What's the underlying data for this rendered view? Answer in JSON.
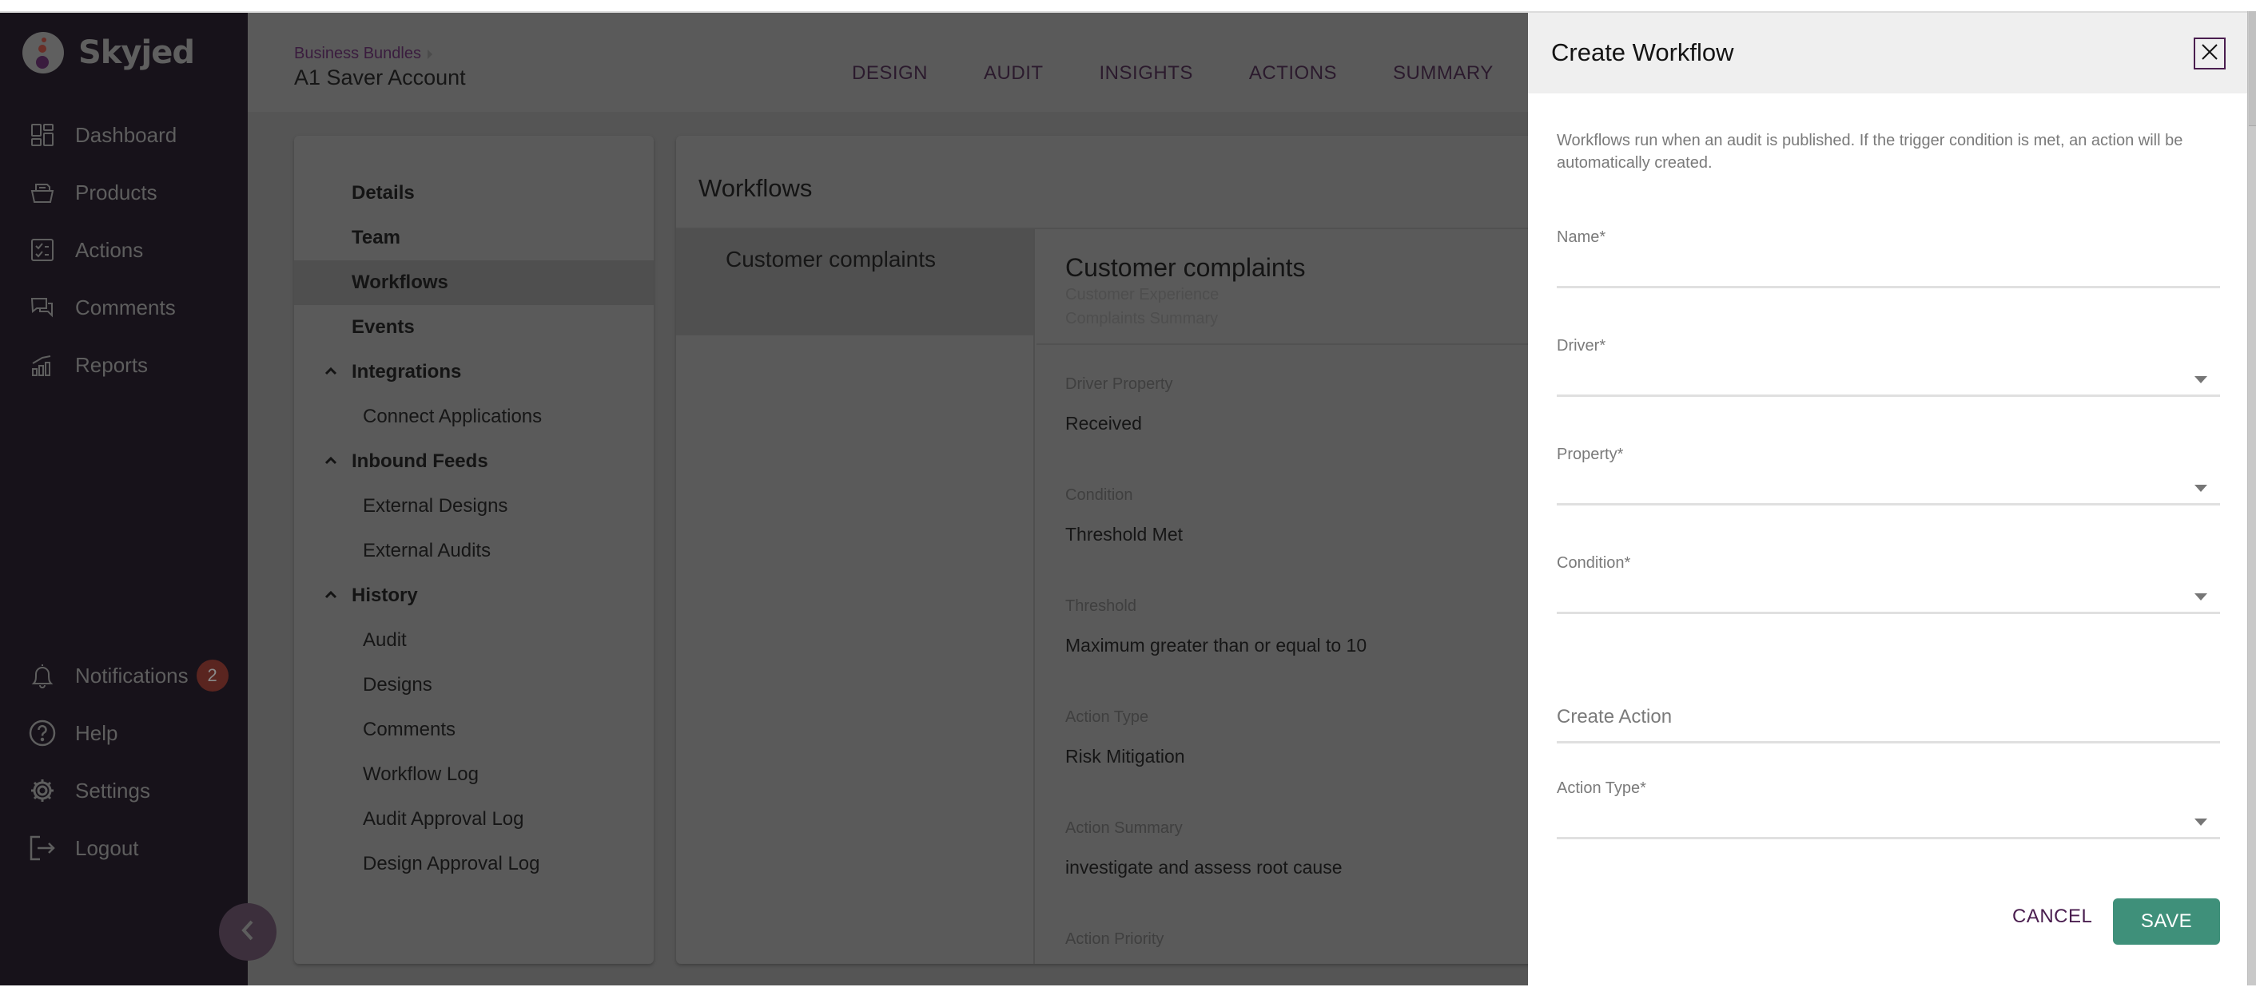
{
  "app": {
    "brand": "Skyjed"
  },
  "sidebar": {
    "items": [
      {
        "label": "Dashboard",
        "icon": "dashboard-icon"
      },
      {
        "label": "Products",
        "icon": "products-icon"
      },
      {
        "label": "Actions",
        "icon": "actions-icon"
      },
      {
        "label": "Comments",
        "icon": "comments-icon"
      },
      {
        "label": "Reports",
        "icon": "reports-icon"
      }
    ],
    "bottom_items": [
      {
        "label": "Notifications",
        "icon": "bell-icon",
        "badge": "2"
      },
      {
        "label": "Help",
        "icon": "help-icon"
      },
      {
        "label": "Settings",
        "icon": "gear-icon"
      },
      {
        "label": "Logout",
        "icon": "logout-icon"
      }
    ],
    "collapse_icon": "chevron-left-icon"
  },
  "header": {
    "breadcrumb": "Business Bundles",
    "title": "A1 Saver Account",
    "tabs": [
      "DESIGN",
      "AUDIT",
      "INSIGHTS",
      "ACTIONS",
      "SUMMARY"
    ]
  },
  "nav_panel": {
    "items": [
      {
        "label": "Details",
        "type": "top"
      },
      {
        "label": "Team",
        "type": "top"
      },
      {
        "label": "Workflows",
        "type": "top",
        "selected": true
      },
      {
        "label": "Events",
        "type": "top"
      },
      {
        "label": "Integrations",
        "type": "group",
        "expanded": true
      },
      {
        "label": "Connect Applications",
        "type": "sub"
      },
      {
        "label": "Inbound Feeds",
        "type": "group",
        "expanded": true
      },
      {
        "label": "External Designs",
        "type": "sub"
      },
      {
        "label": "External Audits",
        "type": "sub"
      },
      {
        "label": "History",
        "type": "group",
        "expanded": true
      },
      {
        "label": "Audit",
        "type": "sub"
      },
      {
        "label": "Designs",
        "type": "sub"
      },
      {
        "label": "Comments",
        "type": "sub"
      },
      {
        "label": "Workflow Log",
        "type": "sub"
      },
      {
        "label": "Audit Approval Log",
        "type": "sub"
      },
      {
        "label": "Design Approval Log",
        "type": "sub"
      }
    ]
  },
  "workflows": {
    "title": "Workflows",
    "list": [
      "Customer complaints"
    ],
    "detail": {
      "name": "Customer complaints",
      "driver": "Customer Experience",
      "summary": "Complaints Summary",
      "fields": [
        {
          "label": "Driver Property",
          "value": "Received"
        },
        {
          "label": "Condition",
          "value": "Threshold Met"
        },
        {
          "label": "Threshold",
          "value": "Maximum greater than or equal to 10"
        },
        {
          "label": "Action Type",
          "value": "Risk Mitigation"
        },
        {
          "label": "Action Summary",
          "value": "investigate and assess root cause"
        },
        {
          "label": "Action Priority",
          "value": ""
        }
      ]
    }
  },
  "dialog": {
    "title": "Create Workflow",
    "description": "Workflows run when an audit is published. If the trigger condition is met, an action will be automatically created.",
    "fields": {
      "name": {
        "label": "Name*",
        "value": ""
      },
      "driver": {
        "label": "Driver*",
        "value": ""
      },
      "property": {
        "label": "Property*",
        "value": ""
      },
      "condition": {
        "label": "Condition*",
        "value": ""
      },
      "action_type": {
        "label": "Action Type*",
        "value": ""
      }
    },
    "section_create_action": "Create Action",
    "cancel_label": "CANCEL",
    "save_label": "SAVE"
  },
  "colors": {
    "brand_purple": "#4a1e4f",
    "save_green": "#3f907a",
    "badge_red": "#5a2520"
  }
}
